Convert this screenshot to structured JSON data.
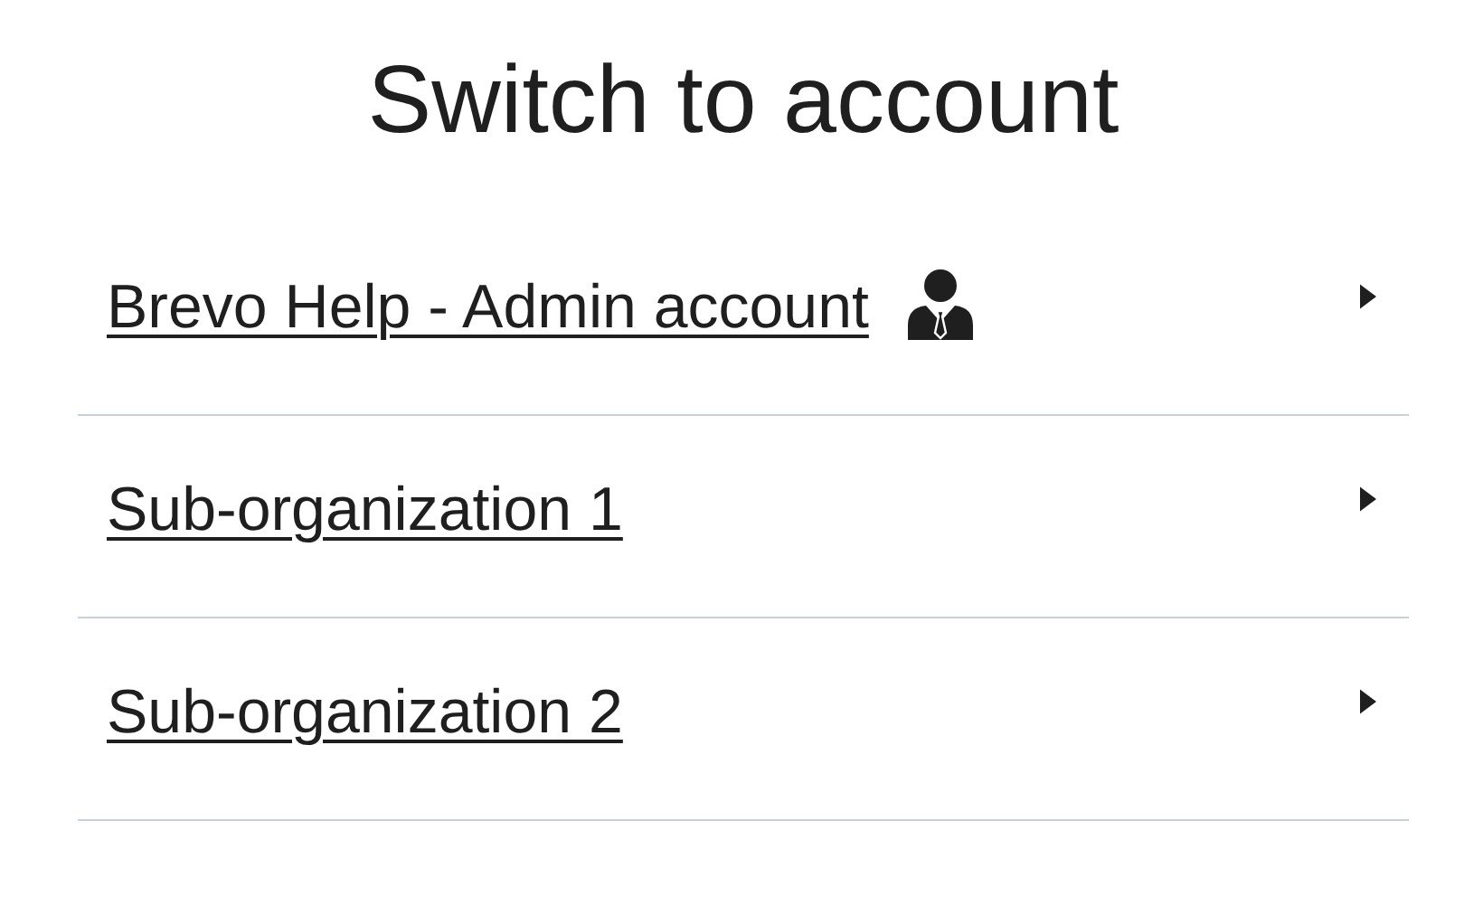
{
  "title": "Switch to account",
  "accounts": [
    {
      "label": "Brevo Help - Admin account",
      "admin": true
    },
    {
      "label": "Sub-organization 1",
      "admin": false
    },
    {
      "label": "Sub-organization 2",
      "admin": false
    }
  ]
}
